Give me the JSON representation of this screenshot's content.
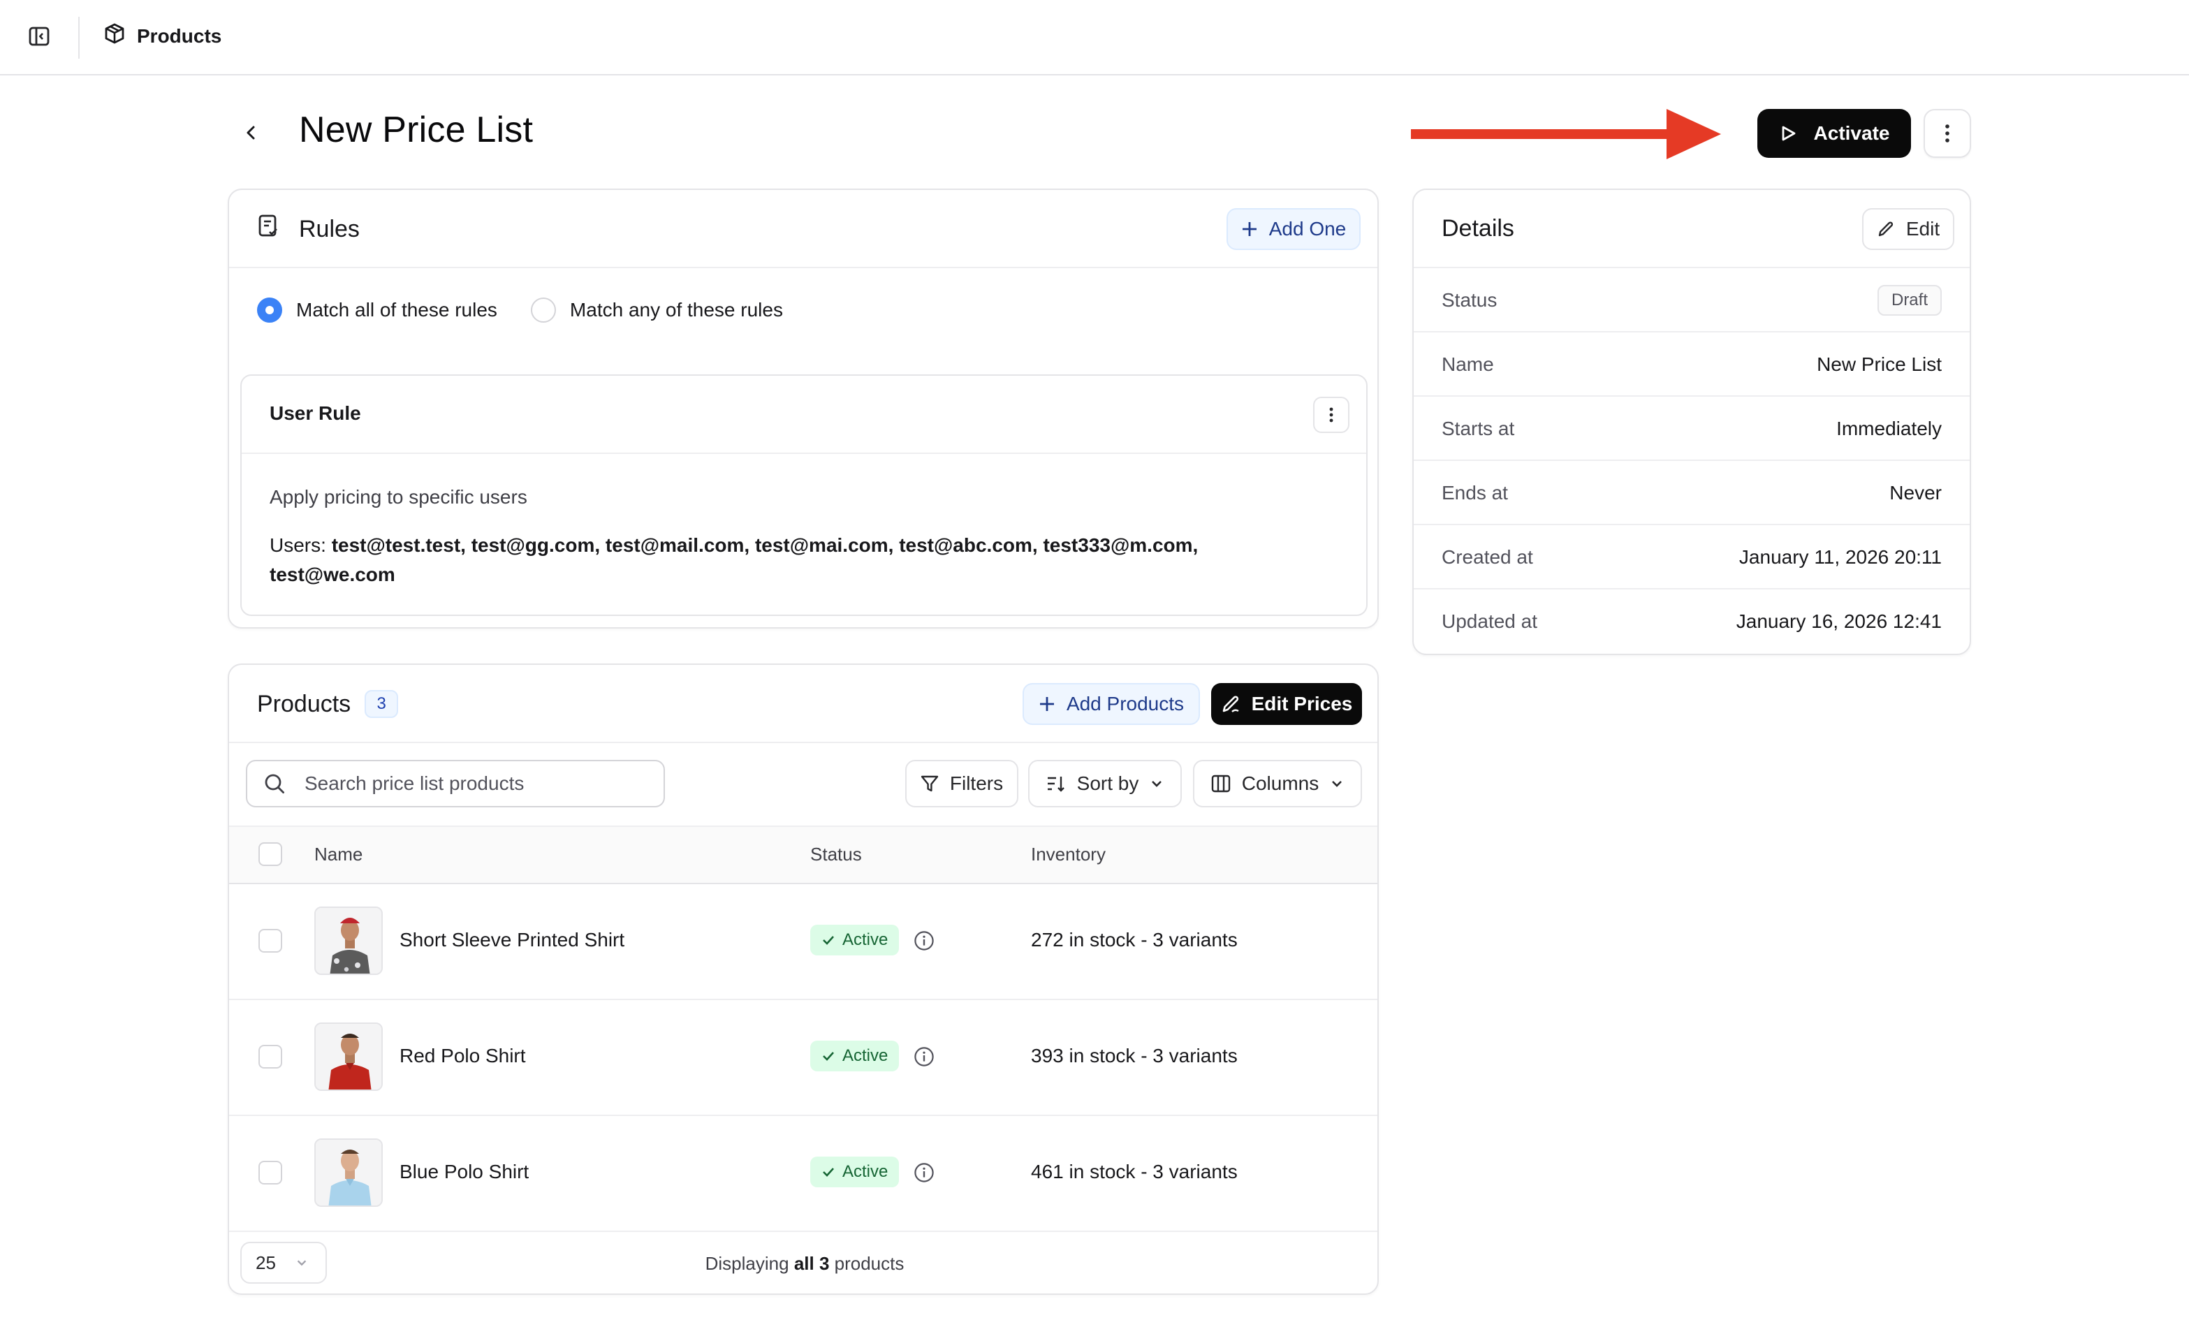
{
  "topbar": {
    "breadcrumb_label": "Products"
  },
  "page": {
    "title": "New Price List",
    "activate_label": "Activate"
  },
  "rules": {
    "title": "Rules",
    "add_label": "Add One",
    "match_all_label": "Match all of these rules",
    "match_any_label": "Match any of these rules",
    "selected_match": "all",
    "user_rule": {
      "title": "User Rule",
      "description": "Apply pricing to specific users",
      "users_prefix": "Users:",
      "users": "test@test.test, test@gg.com, test@mail.com, test@mai.com, test@abc.com, test333@m.com, test@we.com"
    }
  },
  "details": {
    "title": "Details",
    "edit_label": "Edit",
    "rows": [
      {
        "label": "Status",
        "value": "Draft"
      },
      {
        "label": "Name",
        "value": "New Price List"
      },
      {
        "label": "Starts at",
        "value": "Immediately"
      },
      {
        "label": "Ends at",
        "value": "Never"
      },
      {
        "label": "Created at",
        "value": "January 11, 2026 20:11"
      },
      {
        "label": "Updated at",
        "value": "January 16, 2026 12:41"
      }
    ]
  },
  "products": {
    "title": "Products",
    "count": "3",
    "add_label": "Add Products",
    "edit_prices_label": "Edit Prices",
    "search_placeholder": "Search price list products",
    "filters_label": "Filters",
    "sort_label": "Sort by",
    "columns_label": "Columns",
    "columns": {
      "name": "Name",
      "status": "Status",
      "inventory": "Inventory"
    },
    "rows": [
      {
        "name": "Short Sleeve Printed Shirt",
        "status": "Active",
        "inventory": "272 in stock - 3 variants",
        "shirt_color": "#5b5b5b"
      },
      {
        "name": "Red Polo Shirt",
        "status": "Active",
        "inventory": "393 in stock - 3 variants",
        "shirt_color": "#c0261d"
      },
      {
        "name": "Blue Polo Shirt",
        "status": "Active",
        "inventory": "461 in stock - 3 variants",
        "shirt_color": "#a9d3ec"
      }
    ],
    "page_size": "25",
    "footer_prefix": "Displaying",
    "footer_bold": "all 3",
    "footer_suffix": "products"
  },
  "colors": {
    "accent": "#3b82f6",
    "primary_button": "#0a0a0a",
    "annotation_arrow": "#e53a25",
    "active_badge_bg": "#dcfce7",
    "active_badge_text": "#166534"
  }
}
